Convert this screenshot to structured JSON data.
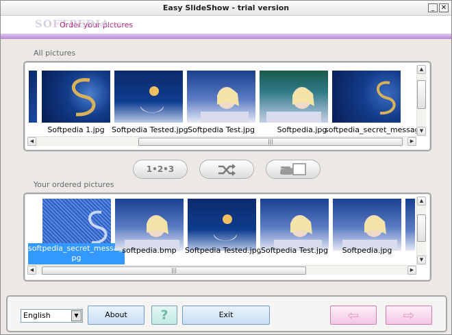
{
  "window": {
    "title": "Easy SlideShow - trial version",
    "controls": {
      "minimize": "_",
      "close": "✕"
    }
  },
  "header": {
    "step_label": "Order your pictures",
    "brand_logo": "SOFTPEDIA",
    "brand_url": "www.softpedia.com"
  },
  "all_pictures": {
    "label": "All pictures",
    "items": [
      {
        "name": "Softpedia 1.jpg"
      },
      {
        "name": "Softpedia Tested.jpg"
      },
      {
        "name": "Softpedia Test.jpg"
      },
      {
        "name": "Softpedia.jpg"
      },
      {
        "name": "softpedia_secret_messag..."
      }
    ]
  },
  "order_controls": {
    "numeric_order_label": "1•2•3",
    "shuffle_icon": "shuffle-icon",
    "manual_icon": "hand-card-icon"
  },
  "ordered_pictures": {
    "label": "Your ordered pictures",
    "selected_caption": "softpedia_secret_message.jpg",
    "selected_caption_line1": "softpedia_secret_message.j",
    "selected_caption_line2": "pg",
    "items": [
      {
        "name": "softpedia.bmp"
      },
      {
        "name": "Softpedia Tested.jpg"
      },
      {
        "name": "Softpedia Test.jpg"
      },
      {
        "name": "Softpedia.jpg"
      }
    ]
  },
  "scroll": {
    "grip": "|||",
    "left_arrow": "◀",
    "right_arrow": "▶",
    "up_arrow": "▲",
    "down_arrow": "▼"
  },
  "footer": {
    "language": "English",
    "about_label": "About",
    "help_label": "?",
    "exit_label": "Exit",
    "back_arrow": "⇦",
    "next_arrow": "⇨"
  },
  "colors": {
    "accent_purple": "#b989d8",
    "header_text": "#b0207a",
    "selection_blue": "#3399ff"
  }
}
